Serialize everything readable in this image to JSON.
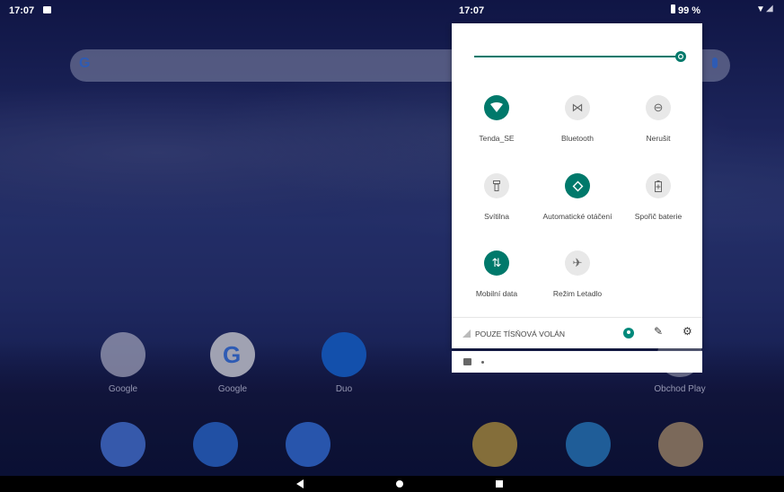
{
  "status_bar": {
    "time_left": "17:07",
    "time_panel": "17:07",
    "battery": "99 %"
  },
  "search": {
    "logo": "G"
  },
  "home": {
    "apps": [
      {
        "label": "Google",
        "icon": "folder-icon"
      },
      {
        "label": "Google",
        "icon": "google-icon"
      },
      {
        "label": "Duo",
        "icon": "duo-icon"
      },
      {
        "label": "Obchod Play",
        "icon": "play-store-icon"
      }
    ],
    "dock": [
      "phone-icon",
      "contacts-icon",
      "messages-icon",
      "chrome-icon",
      "settings-app-icon",
      "camera-icon"
    ]
  },
  "quick_settings": {
    "brightness": 1.0,
    "tiles": [
      {
        "label": "Tenda_SE",
        "icon": "wifi-icon",
        "on": true
      },
      {
        "label": "Bluetooth",
        "icon": "bluetooth-icon",
        "on": false
      },
      {
        "label": "Nerušit",
        "icon": "dnd-icon",
        "on": false
      },
      {
        "label": "Svítilna",
        "icon": "flashlight-icon",
        "on": false
      },
      {
        "label": "Automatické otáčení",
        "icon": "rotate-icon",
        "on": true
      },
      {
        "label": "Spořič baterie",
        "icon": "battery-saver-icon",
        "on": false
      },
      {
        "label": "Mobilní data",
        "icon": "mobile-data-icon",
        "on": true
      },
      {
        "label": "Režim Letadlo",
        "icon": "airplane-icon",
        "on": false
      }
    ],
    "footer_text": "POUZE TÍSŇOVÁ VOLÁN",
    "accent": "#00796b"
  }
}
